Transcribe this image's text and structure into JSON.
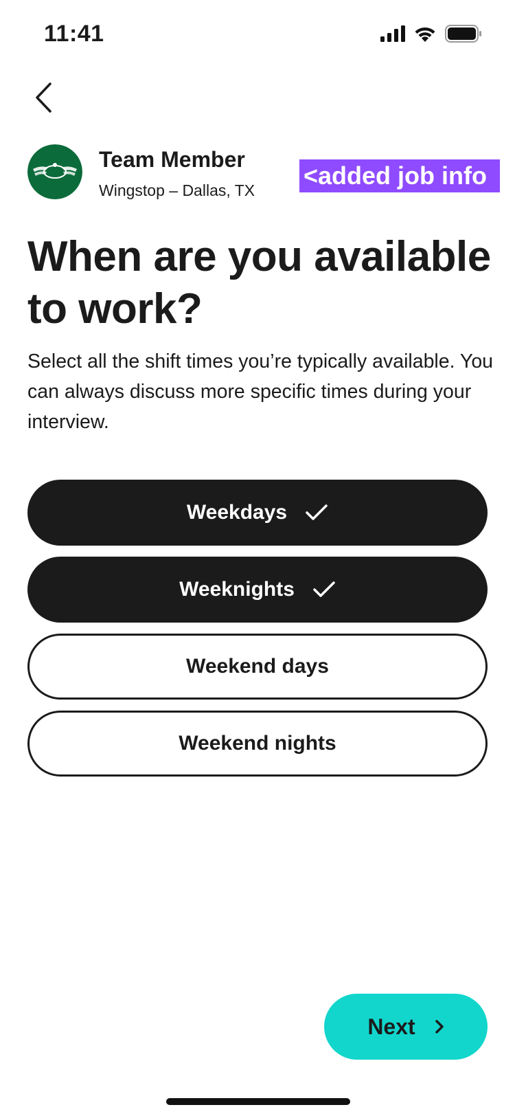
{
  "status_bar": {
    "time": "11:41",
    "icons": [
      "cellular-signal-icon",
      "wifi-icon",
      "battery-icon"
    ]
  },
  "navigation": {
    "back_icon": "chevron-left-icon"
  },
  "job": {
    "title": "Team Member",
    "location": "Wingstop – Dallas, TX",
    "logo_text": "WING STOP",
    "logo_color": "#0b6b3a"
  },
  "annotation": {
    "text": "<added job info",
    "color": "#8f4bff"
  },
  "page": {
    "title": "When are you available to work?",
    "description": "Select all the shift times you’re typically available. You can always discuss more specific times during your interview."
  },
  "options": [
    {
      "label": "Weekdays",
      "selected": true
    },
    {
      "label": "Weeknights",
      "selected": true
    },
    {
      "label": "Weekend days",
      "selected": false
    },
    {
      "label": "Weekend nights",
      "selected": false
    }
  ],
  "next_button": {
    "label": "Next",
    "icon": "chevron-right-icon",
    "color": "#12d6cc"
  }
}
